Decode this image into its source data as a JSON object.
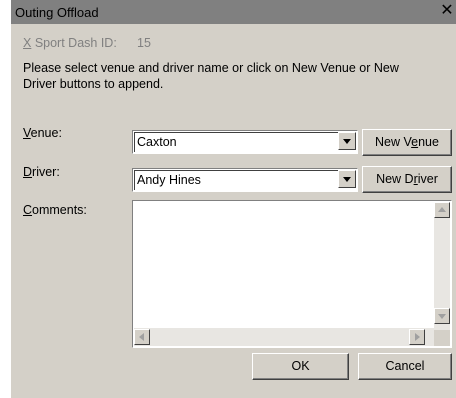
{
  "window": {
    "title": "Outing Offload",
    "close_glyph": "✕"
  },
  "header": {
    "sport_dash_prefix": "X",
    "sport_dash_label": " Sport Dash ID:",
    "sport_dash_value": "15",
    "instructions_line1": "Please select venue and driver name or click on New Venue or New",
    "instructions_line2": "Driver buttons to append."
  },
  "form": {
    "venue_label_key": "V",
    "venue_label_rest": "enue:",
    "venue_value": "Caxton",
    "new_venue_pre": "New V",
    "new_venue_key": "e",
    "new_venue_post": "nue",
    "driver_label_key": "D",
    "driver_label_rest": "river:",
    "driver_value": "Andy Hines",
    "new_driver_pre": "New D",
    "new_driver_key": "r",
    "new_driver_post": "iver",
    "comments_label_key": "C",
    "comments_label_rest": "omments:",
    "comments_value": ""
  },
  "buttons": {
    "ok": "OK",
    "cancel": "Cancel"
  },
  "icons": {
    "combo_arrow": "chevron-down-icon",
    "scroll_up": "scroll-up-arrow-icon",
    "scroll_down": "scroll-down-arrow-icon",
    "scroll_left": "scroll-left-arrow-icon",
    "scroll_right": "scroll-right-arrow-icon"
  },
  "colors": {
    "dialog_face": "#d4d0c8",
    "titlebar": "#808080",
    "disabled_text": "#808080"
  }
}
